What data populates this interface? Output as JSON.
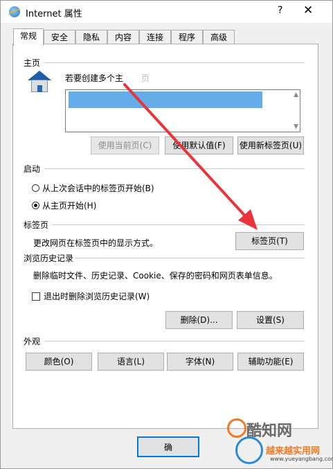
{
  "window": {
    "title": "Internet 属性",
    "help_symbol": "?",
    "close_symbol": "✕"
  },
  "tabs": [
    {
      "label": "常规",
      "active": true
    },
    {
      "label": "安全"
    },
    {
      "label": "隐私"
    },
    {
      "label": "内容"
    },
    {
      "label": "连接"
    },
    {
      "label": "程序"
    },
    {
      "label": "高级"
    }
  ],
  "homepage": {
    "label": "主页",
    "hint": "若要创建多个主",
    "hint_suffix": "页",
    "buttons": {
      "use_current": "使用当前页(C)",
      "use_default": "使用默认值(F)",
      "use_new_tab": "使用新标签页(U)"
    }
  },
  "startup": {
    "label": "启动",
    "options": [
      {
        "label": "从上次会话中的标签页开始(B)",
        "checked": false
      },
      {
        "label": "从主页开始(H)",
        "checked": true
      }
    ]
  },
  "tabs_section": {
    "label": "标签页",
    "description": "更改网页在标签页中的显示方式。",
    "button": "标签页(T)"
  },
  "history": {
    "label": "浏览历史记录",
    "description": "删除临时文件、历史记录、Cookie、保存的密码和网页表单信息。",
    "checkbox": "退出时删除浏览历史记录(W)",
    "delete_button": "删除(D)...",
    "settings_button": "设置(S)"
  },
  "appearance": {
    "label": "外观",
    "buttons": [
      "颜色(O)",
      "语言(L)",
      "字体(N)",
      "辅助功能(E)"
    ]
  },
  "footer": {
    "ok_label": "确"
  },
  "watermark": {
    "main": "酷知网",
    "brand": "越来越实用网",
    "url": "www.yueyangbang.com"
  },
  "colors": {
    "arrow": "#e8343a",
    "focus": "#0078d7"
  }
}
